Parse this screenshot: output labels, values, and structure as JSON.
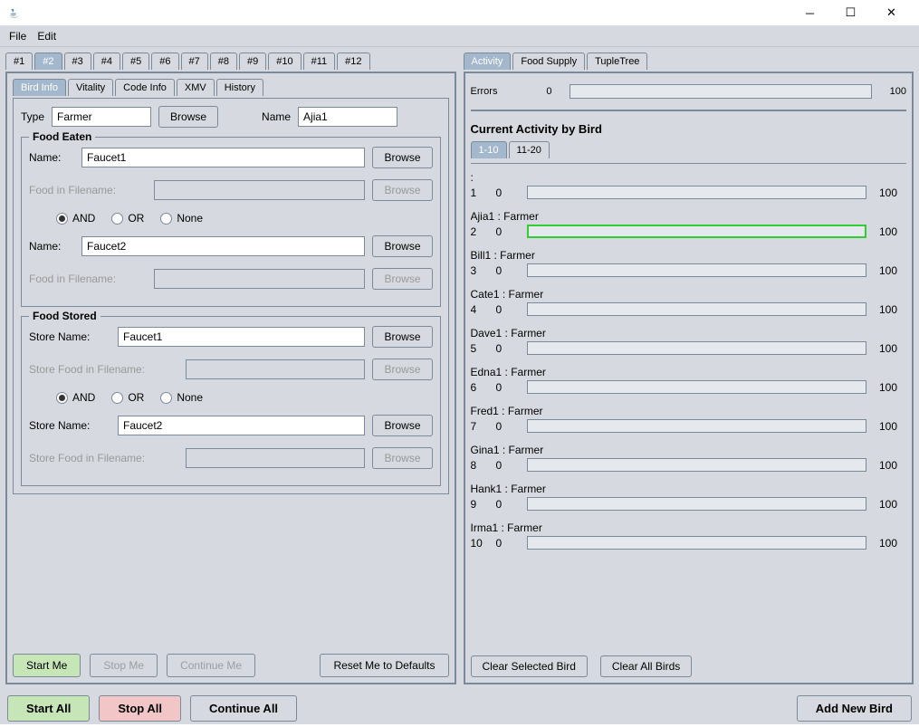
{
  "menu": {
    "file": "File",
    "edit": "Edit"
  },
  "outerTabs": [
    "#1",
    "#2",
    "#3",
    "#4",
    "#5",
    "#6",
    "#7",
    "#8",
    "#9",
    "#10",
    "#11",
    "#12"
  ],
  "outerTabActive": "#2",
  "innerTabs": [
    "Bird Info",
    "Vitality",
    "Code Info",
    "XMV",
    "History"
  ],
  "innerTabActive": "Bird Info",
  "birdInfo": {
    "typeLabel": "Type",
    "typeValue": "Farmer",
    "browse": "Browse",
    "nameLabel": "Name",
    "nameValue": "Ajia1"
  },
  "foodEaten": {
    "title": "Food Eaten",
    "nameLabel": "Name:",
    "name1": "Faucet1",
    "browse": "Browse",
    "foodFilenameLabel": "Food in Filename:",
    "radios": {
      "and": "AND",
      "or": "OR",
      "none": "None",
      "checked": "AND"
    },
    "name2": "Faucet2"
  },
  "foodStored": {
    "title": "Food Stored",
    "storeNameLabel": "Store Name:",
    "store1": "Faucet1",
    "browse": "Browse",
    "storeFilenameLabel": "Store Food in Filename:",
    "radios": {
      "and": "AND",
      "or": "OR",
      "none": "None",
      "checked": "AND"
    },
    "store2": "Faucet2"
  },
  "leftButtons": {
    "start": "Start Me",
    "stop": "Stop Me",
    "cont": "Continue Me",
    "reset": "Reset Me to Defaults"
  },
  "globalButtons": {
    "startAll": "Start All",
    "stopAll": "Stop All",
    "contAll": "Continue All",
    "addBird": "Add New Bird"
  },
  "rightTabs": [
    "Activity",
    "Food Supply",
    "TupleTree"
  ],
  "rightTabActive": "Activity",
  "errors": {
    "label": "Errors",
    "value": "0",
    "max": "100"
  },
  "activityHeader": "Current Activity by Bird",
  "pageTabs": [
    "1-10",
    "11-20"
  ],
  "pageTabActive": "1-10",
  "activityRows": [
    {
      "idx": "1",
      "label": ":",
      "val": "0",
      "max": "100",
      "hl": false
    },
    {
      "idx": "2",
      "label": "Ajia1 : Farmer",
      "val": "0",
      "max": "100",
      "hl": true
    },
    {
      "idx": "3",
      "label": "Bill1 : Farmer",
      "val": "0",
      "max": "100",
      "hl": false
    },
    {
      "idx": "4",
      "label": "Cate1 : Farmer",
      "val": "0",
      "max": "100",
      "hl": false
    },
    {
      "idx": "5",
      "label": "Dave1 : Farmer",
      "val": "0",
      "max": "100",
      "hl": false
    },
    {
      "idx": "6",
      "label": "Edna1 : Farmer",
      "val": "0",
      "max": "100",
      "hl": false
    },
    {
      "idx": "7",
      "label": "Fred1 : Farmer",
      "val": "0",
      "max": "100",
      "hl": false
    },
    {
      "idx": "8",
      "label": "Gina1 : Farmer",
      "val": "0",
      "max": "100",
      "hl": false
    },
    {
      "idx": "9",
      "label": "Hank1 : Farmer",
      "val": "0",
      "max": "100",
      "hl": false
    },
    {
      "idx": "10",
      "label": "Irma1 : Farmer",
      "val": "0",
      "max": "100",
      "hl": false
    }
  ],
  "rightButtons": {
    "clearSel": "Clear Selected Bird",
    "clearAll": "Clear All Birds"
  }
}
